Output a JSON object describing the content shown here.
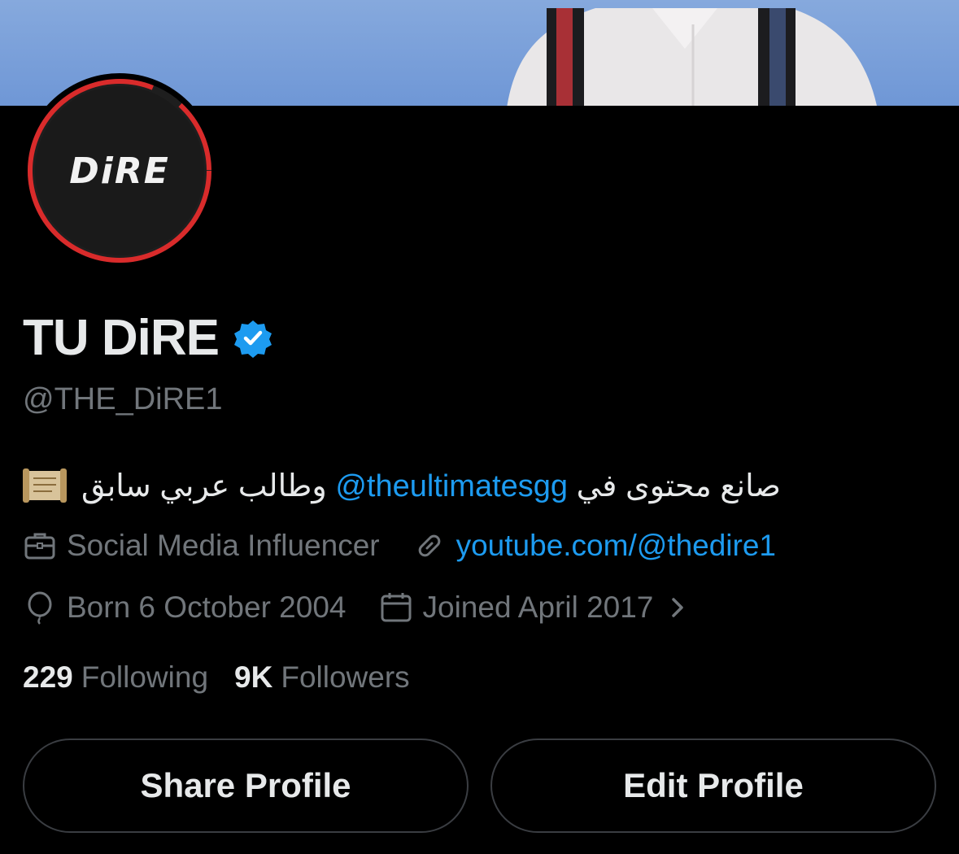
{
  "profile": {
    "display_name": "TU DiRE",
    "handle": "@THE_DiRE1",
    "avatar_text": "DiRE",
    "bio_prefix": "صانع محتوى في ",
    "bio_mention": "@theultimatesgg",
    "bio_suffix": " وطالب عربي سابق",
    "category": "Social Media Influencer",
    "website": "youtube.com/@thedire1",
    "birthday": "Born 6 October 2004",
    "joined": "Joined April 2017"
  },
  "stats": {
    "following_count": "229",
    "following_label": "Following",
    "followers_count": "9K",
    "followers_label": "Followers"
  },
  "actions": {
    "share_label": "Share Profile",
    "edit_label": "Edit Profile"
  },
  "colors": {
    "background": "#000000",
    "accent": "#1d9bf0",
    "muted": "#71767b",
    "text": "#e7e9ea",
    "avatar_ring": "#d92b2b"
  },
  "icons": {
    "verified": "verified-badge-icon",
    "bio_emoji": "scroll-icon",
    "category": "briefcase-icon",
    "website": "link-icon",
    "birthday": "balloon-icon",
    "joined": "calendar-icon",
    "joined_more": "chevron-right-icon"
  }
}
